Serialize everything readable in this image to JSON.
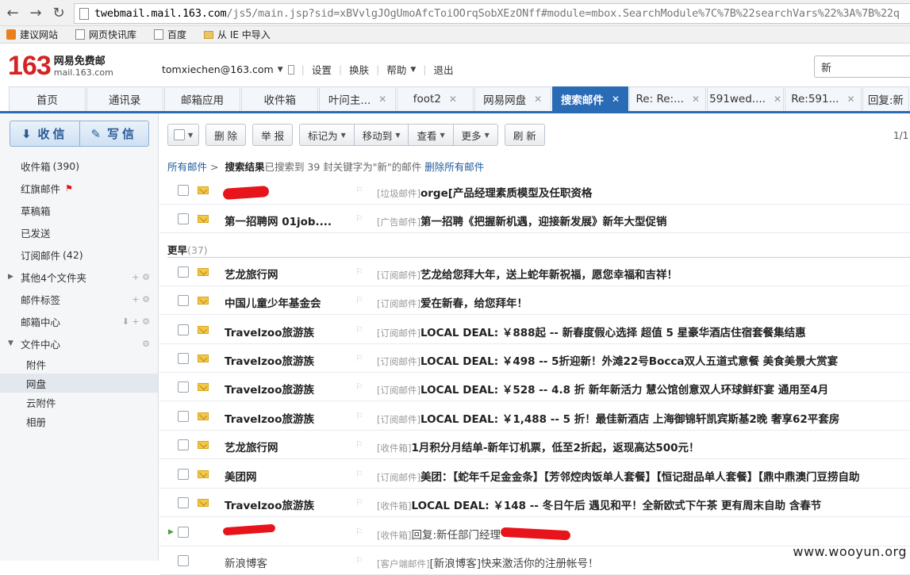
{
  "browser": {
    "url_host": "twebmail.mail.163.com",
    "url_rest": "/js5/main.jsp?sid=xBVvlgJOgUmoAfcToiOOrqSobXEzONff#module=mbox.SearchModule%7C%7B%22searchVars%22%3A%7B%22q",
    "bookmarks": [
      "建议网站",
      "网页快讯库",
      "百度",
      "从 IE 中导入"
    ]
  },
  "header": {
    "logo_num": "163",
    "logo_cn": "网易免费邮",
    "logo_domain": "mail.163.com",
    "user": "tomxiechen@163.com",
    "links": [
      "设置",
      "换肤",
      "帮助",
      "退出"
    ],
    "search_value": "新"
  },
  "tabs": [
    {
      "label": "首页",
      "closable": false
    },
    {
      "label": "通讯录",
      "closable": false
    },
    {
      "label": "邮箱应用",
      "closable": false
    },
    {
      "label": "收件箱",
      "closable": false
    },
    {
      "label": "叶问主...",
      "closable": true
    },
    {
      "label": "foot2",
      "closable": true
    },
    {
      "label": "网易网盘",
      "closable": true
    },
    {
      "label": "搜索邮件",
      "closable": true,
      "active": true
    },
    {
      "label": "Re: Re:...",
      "closable": true
    },
    {
      "label": "591wed....",
      "closable": true
    },
    {
      "label": "Re:591...",
      "closable": true
    },
    {
      "label": "回复:新",
      "closable": false
    }
  ],
  "sidebar": {
    "receive_label": "收信",
    "write_label": "写信",
    "folders": [
      {
        "label": "收件箱",
        "count": "(390)",
        "bold_count": true
      },
      {
        "label": "红旗邮件",
        "flag": true
      },
      {
        "label": "草稿箱"
      },
      {
        "label": "已发送"
      },
      {
        "label": "订阅邮件",
        "count": "(42)",
        "bold_count": true
      },
      {
        "label": "其他4个文件夹",
        "expand": "▶",
        "ops": "+ ⚙"
      },
      {
        "label": "邮件标签",
        "ops": "+ ⚙"
      },
      {
        "label": "邮箱中心",
        "ops": "⬇ + ⚙"
      },
      {
        "label": "文件中心",
        "expand": "▼",
        "ops": "⚙"
      },
      {
        "label": "附件",
        "sub": true
      },
      {
        "label": "网盘",
        "sub": true,
        "selected": true
      },
      {
        "label": "云附件",
        "sub": true
      },
      {
        "label": "相册",
        "sub": true
      }
    ]
  },
  "toolbar": {
    "delete": "删 除",
    "report": "举 报",
    "mark": "标记为",
    "move": "移动到",
    "view": "查看",
    "more": "更多",
    "refresh": "刷 新",
    "pager": "1/1"
  },
  "breadcrumb": {
    "all": "所有邮件",
    "sep": ">",
    "title": "搜索结果",
    "desc": "已搜索到 39 封关键字为\"新\"的邮件",
    "delete_all": "删除所有邮件"
  },
  "group_earlier": {
    "label": "更早",
    "count": "(37)"
  },
  "mails": [
    {
      "sender": "",
      "tag": "[垃圾邮件]",
      "subject": "orge[产品经理素质模型及任职资格",
      "redacted_sender": true
    },
    {
      "sender": "第一招聘网 01job....",
      "tag": "[广告邮件]",
      "subject": "第一招聘《把握新机遇，迎接新发展》新年大型促销"
    },
    {
      "sender": "艺龙旅行网",
      "tag": "[订阅邮件]",
      "subject": "艺龙给您拜大年，送上蛇年新祝福，愿您幸福和吉祥！"
    },
    {
      "sender": "中国儿童少年基金会",
      "tag": "[订阅邮件]",
      "subject": "爱在新春，给您拜年！"
    },
    {
      "sender": "Travelzoo旅游族",
      "tag": "[订阅邮件]",
      "subject": "LOCAL DEAL: ￥888起 -- 新春度假心选择 超值 5 星豪华酒店住宿套餐集结惠"
    },
    {
      "sender": "Travelzoo旅游族",
      "tag": "[订阅邮件]",
      "subject": "LOCAL DEAL: ￥498 -- 5折迎新！外滩22号Bocca双人五道式意餐 美食美景大赏宴"
    },
    {
      "sender": "Travelzoo旅游族",
      "tag": "[订阅邮件]",
      "subject": "LOCAL DEAL: ￥528 -- 4.8 折 新年新活力 慧公馆创意双人环球鲜虾宴 通用至4月"
    },
    {
      "sender": "Travelzoo旅游族",
      "tag": "[订阅邮件]",
      "subject": "LOCAL DEAL: ￥1,488 -- 5 折！最佳新酒店 上海御锦轩凯宾斯基2晚 奢享62平套房"
    },
    {
      "sender": "艺龙旅行网",
      "tag": "[收件箱]",
      "subject": "1月积分月结单-新年订机票，低至2折起，返现高达500元！"
    },
    {
      "sender": "美团网",
      "tag": "[订阅邮件]",
      "subject": "美团：【蛇年千足金金条】【芳邻焢肉饭单人套餐】【恒记甜品单人套餐】【鼎中鼎澳门豆捞自助"
    },
    {
      "sender": "Travelzoo旅游族",
      "tag": "[收件箱]",
      "subject": "LOCAL DEAL: ￥148 -- 冬日午后 遇见和平！全新欧式下午茶 更有周末自助 含春节"
    },
    {
      "sender": "",
      "tag": "[收件箱]",
      "subject": "回复:新任部门经理",
      "redacted_sender": true,
      "read": true,
      "marker": "▶"
    },
    {
      "sender": "新浪博客",
      "tag": "[客户端邮件]",
      "subject": "[新浪博客]快来激活你的注册帐号！",
      "read": true
    }
  ],
  "watermark": "www.wooyun.org"
}
